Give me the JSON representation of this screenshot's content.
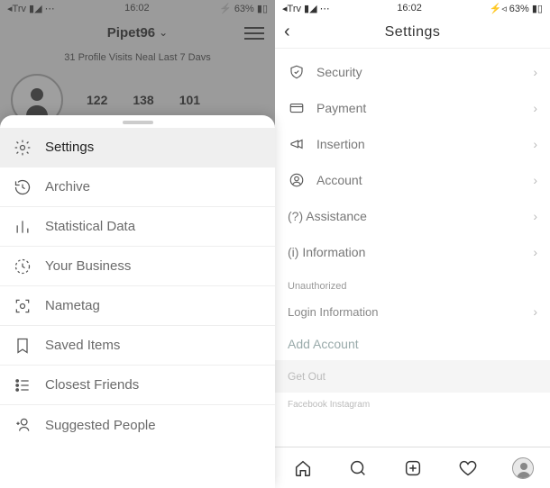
{
  "left": {
    "status": {
      "carrier": "◂Trv ▮◢ ⋯",
      "time": "16:02",
      "battery": "⚡ 63% ▮▯"
    },
    "username": "Pipet96",
    "visits": "31 Profile Visits Neal Last 7 Davs",
    "stats": [
      "122",
      "138",
      "101"
    ],
    "sheet": [
      {
        "label": "Settings"
      },
      {
        "label": "Archive"
      },
      {
        "label": "Statistical Data"
      },
      {
        "label": "Your Business"
      },
      {
        "label": "Nametag"
      },
      {
        "label": "Saved Items"
      },
      {
        "label": "Closest Friends"
      },
      {
        "label": "Suggested People"
      }
    ]
  },
  "right": {
    "status": {
      "carrier": "◂Trv ▮◢ ⋯",
      "time": "16:02",
      "battery": "⚡◃ 63% ▮▯"
    },
    "title": "Settings",
    "items": [
      {
        "label": "Security"
      },
      {
        "label": "Payment"
      },
      {
        "label": "Insertion"
      },
      {
        "label": "Account"
      },
      {
        "label": "(?) Assistance"
      },
      {
        "label": "(i) Information"
      }
    ],
    "section": "Unauthorized",
    "login_info": "Login Information",
    "add_account": "Add Account",
    "logout": "Get Out",
    "footer": "Facebook Instagram"
  }
}
